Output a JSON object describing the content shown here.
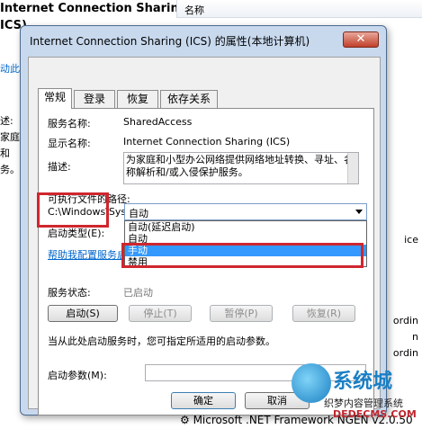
{
  "background": {
    "title": "Internet Connection Sharing",
    "title_suffix": "ICS)",
    "column_header": "名称",
    "left_fragments": [
      "动此",
      "述:",
      "家庭",
      "和",
      "务。"
    ],
    "right_fragments": [
      "ice",
      "ordin",
      "n",
      "ordin"
    ],
    "bottom_row": "Microsoft .NET Framework NGEN v2.0.50"
  },
  "dialog": {
    "title": "Internet Connection Sharing (ICS) 的属性(本地计算机)",
    "close_glyph": "✕",
    "tabs": [
      {
        "label": "常规",
        "active": true
      },
      {
        "label": "登录",
        "active": false
      },
      {
        "label": "恢复",
        "active": false
      },
      {
        "label": "依存关系",
        "active": false
      }
    ],
    "service_name_label": "服务名称:",
    "service_name_value": "SharedAccess",
    "display_name_label": "显示名称:",
    "display_name_value": "Internet Connection Sharing (ICS)",
    "description_label": "描述:",
    "description_value": "为家庭和小型办公网络提供网络地址转换、寻址、名称解析和/或入侵保护服务。",
    "path_label": "可执行文件的路径:",
    "path_value": "C:\\Windows\\System32\\svchost.exe -k netsvcs",
    "startup_type_label": "启动类型(E):",
    "startup_type_value": "自动",
    "startup_options": [
      "自动(延迟启动)",
      "自动",
      "手动",
      "禁用"
    ],
    "startup_selected": "手动",
    "help_link": "帮助我配置服务启",
    "service_status_label": "服务状态:",
    "status_value": "已启动",
    "buttons": {
      "start": "启动(S)",
      "stop": "停止(T)",
      "pause": "暂停(P)",
      "resume": "恢复(R)"
    },
    "start_params_note": "当从此处启动服务时，您可指定所适用的启动参数。",
    "start_params_label": "启动参数(M):",
    "start_params_value": "",
    "ok": "确定",
    "cancel": "取消"
  },
  "watermark": {
    "brand": "系统城",
    "subtitle": "织梦内容管理系统",
    "url": "DEDECMS.COM"
  }
}
